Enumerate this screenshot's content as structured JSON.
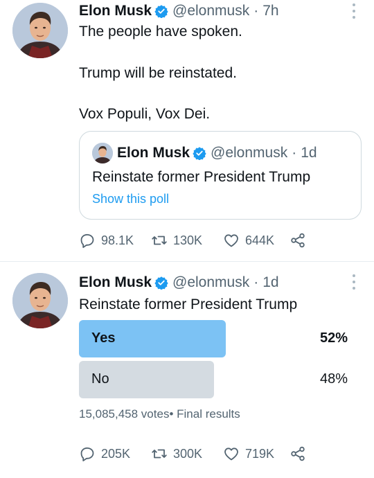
{
  "tweets": [
    {
      "author": {
        "name": "Elon Musk",
        "handle": "@elonmusk"
      },
      "separator": "·",
      "time": "7h",
      "lines": [
        "The people have spoken.",
        "Trump will be reinstated.",
        "Vox Populi, Vox Dei."
      ],
      "quote": {
        "author": {
          "name": "Elon Musk",
          "handle": "@elonmusk"
        },
        "time": "1d",
        "text": "Reinstate former President Trump",
        "link_label": "Show this poll"
      },
      "stats": {
        "replies": "98.1K",
        "retweets": "130K",
        "likes": "644K"
      }
    },
    {
      "author": {
        "name": "Elon Musk",
        "handle": "@elonmusk"
      },
      "separator": "·",
      "time": "1d",
      "text": "Reinstate former President Trump",
      "poll": {
        "options": [
          {
            "label": "Yes",
            "percent": "52%",
            "value": 52,
            "winner": true
          },
          {
            "label": "No",
            "percent": "48%",
            "value": 48,
            "winner": false
          }
        ],
        "votes": "15,085,458 votes",
        "status": "• Final results"
      },
      "stats": {
        "replies": "205K",
        "retweets": "300K",
        "likes": "719K"
      }
    }
  ],
  "icons": {
    "verified": "verified-badge-icon",
    "more": "more-vertical-icon",
    "reply": "reply-icon",
    "retweet": "retweet-icon",
    "like": "heart-icon",
    "share": "share-icon"
  },
  "colors": {
    "accent": "#1d9bf0",
    "poll_winner_bar": "#7cc2f4",
    "poll_other_bar": "#d4dbe1",
    "secondary_text": "#536471",
    "verified": "#1d9bf0"
  }
}
